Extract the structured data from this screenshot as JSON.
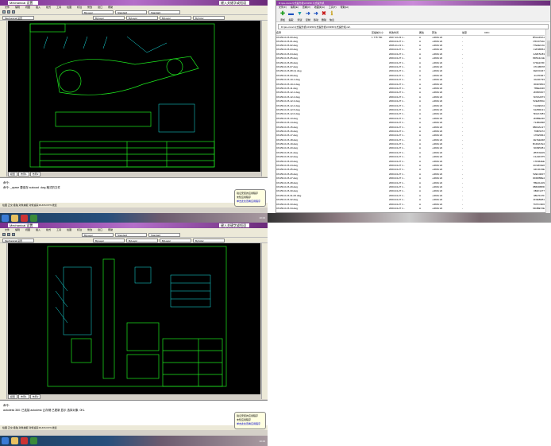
{
  "cad": {
    "title_field": "Mechanical 设置",
    "search_field": "键入关键字或短语",
    "menus": [
      "文件",
      "编辑",
      "视图",
      "插入",
      "格式",
      "工具",
      "绘图",
      "标注",
      "修改",
      "窗口",
      "帮助"
    ],
    "toolbar_selects": [
      "Mechanical 设置",
      "ByLayer",
      "Standard",
      "Standard"
    ],
    "layer_selects": [
      "ByLayer",
      "ByLayer",
      "ByLayer",
      "ByColor"
    ],
    "tabs": [
      "模型",
      "布局1",
      "布局2"
    ],
    "line_color": "#1ee81e",
    "accent_color": "#19e6e6"
  },
  "top_cad": {
    "cmd_lines": [
      "命令:",
      "命令: _qsave 要保存 autocad .dwg 格式的文件"
    ],
    "status": "绘图 正交 极轴 对象捕捉 对象追踪 DUCS DYN 线宽"
  },
  "bottom_cad": {
    "cmd_lines": [
      "命令:",
      "autodesk 360: 已连接 autodesk 云存储 已更新 显示 选择对象: 0KL"
    ],
    "status": "绘图 正交 极轴 对象捕捉 对象追踪 DUCS DYN 线宽"
  },
  "balloon": {
    "title": "验证安装的应用程序",
    "body": "未知应用程序",
    "link": "单击此处查看应用程序"
  },
  "explorer": {
    "title": "D:\\pre-zone\\斗式提升机\\CN150 斗式提升机",
    "menus": [
      "文件(F)",
      "编辑(E)",
      "查看(V)",
      "收藏夹(A)",
      "工具(T)",
      "帮助(H)"
    ],
    "tools": [
      {
        "icon": "add-icon",
        "label": "添加",
        "glyph": "✚"
      },
      {
        "icon": "extract-icon",
        "label": "提取",
        "glyph": "▬"
      },
      {
        "icon": "test-icon",
        "label": "测试",
        "glyph": "▼"
      },
      {
        "icon": "copy-icon",
        "label": "复制",
        "glyph": "➜"
      },
      {
        "icon": "move-icon",
        "label": "移动",
        "glyph": "➜"
      },
      {
        "icon": "delete-icon",
        "label": "删除",
        "glyph": "✖"
      },
      {
        "icon": "info-icon",
        "label": "信息",
        "glyph": "ℹ"
      }
    ],
    "address": "D:\\pre-zone\\斗式提升机\\CN150斗式提升机\\CN150斗式提升机.rar\\",
    "columns": [
      "名称",
      "压缩前大小",
      "修改时间",
      "属性",
      "注释",
      "算法",
      "加密",
      "创建时间",
      "访问时间",
      "CRC"
    ],
    "rows": [
      [
        "CN150-0-15-00.dwg",
        "1 778 790",
        "2007-10-23 1...",
        "A",
        "-LZMA:24",
        "-",
        "B5AAF6A1"
      ],
      [
        "CN150-0-15-01.dwg",
        "",
        "2003-04-27 1...",
        "A",
        "-LZMA:24",
        "-",
        "C5C0794A"
      ],
      [
        "CN150-0-15-02.dwg",
        "",
        "2006-11-21 1...",
        "A",
        "-LZMA:24",
        "-",
        "77E2EC2A"
      ],
      [
        "CN150-0-15-03.dwg",
        "",
        "2003-04-27 1...",
        "A",
        "-LZMA:24",
        "-",
        "C2F9B654"
      ],
      [
        "CN150-0-15-04.dwg",
        "",
        "2003-04-27 1...",
        "A",
        "-LZMA:24",
        "-",
        "4A8F5C83"
      ],
      [
        "CN150-0-15-05.dwg",
        "",
        "2003-04-27 1...",
        "A",
        "-LZMA:24",
        "-",
        "8D5A3A1E"
      ],
      [
        "CN150-0-15-06.dwg",
        "",
        "2003-04-27 1...",
        "A",
        "-LZMA:24",
        "-",
        "37FE2C5F"
      ],
      [
        "CN150-0-15-07.dwg",
        "",
        "2003-04-27 1...",
        "A",
        "-LZMA:24",
        "-",
        "47C4B678"
      ],
      [
        "CN150-0-15-08 (1).dwg",
        "",
        "2003-04-27 1...",
        "A",
        "-LZMA:24",
        "-",
        "3EF0C047"
      ],
      [
        "CN150-0-15-09.dwg",
        "",
        "2003-04-27 1...",
        "A",
        "-LZMA:24",
        "-",
        "2147F847"
      ],
      [
        "CN150-0-15-10-1.dwg",
        "",
        "2003-04-27 1...",
        "A",
        "-LZMA:24",
        "-",
        "3A44F793"
      ],
      [
        "CN150-0-15-10-2.dwg",
        "",
        "2003-04-27 1...",
        "A",
        "-LZMA:24",
        "-",
        "3D4F9504"
      ],
      [
        "CN150-0-15-11.dwg",
        "",
        "2003-04-27 1...",
        "A",
        "-LZMA:24",
        "-",
        "789E2220"
      ],
      [
        "CN150-0-15-12-1.dwg",
        "",
        "2003-04-27 1...",
        "A",
        "-LZMA:24",
        "-",
        "2F8D6F07"
      ],
      [
        "CN150-0-15-12-2.dwg",
        "",
        "2003-04-27 1...",
        "A",
        "-LZMA:24",
        "-",
        "6C5A2073"
      ],
      [
        "CN150-0-15-12-3.dwg",
        "",
        "2003-04-27 1...",
        "A",
        "-LZMA:24",
        "-",
        "52E2D50A"
      ],
      [
        "CN150-0-15-12-4.dwg",
        "",
        "2003-04-27 1...",
        "A",
        "-LZMA:24",
        "-",
        "71A0E5A3"
      ],
      [
        "CN150-0-15-12-5.dwg",
        "",
        "2003-04-27 1...",
        "A",
        "-LZMA:24",
        "-",
        "612B9C21"
      ],
      [
        "CN150-0-15-12-6.dwg",
        "",
        "2003-04-27 1...",
        "A",
        "-LZMA:24",
        "-",
        "5D4A7283"
      ],
      [
        "CN150-0-15-13.dwg",
        "",
        "2003-04-27 1...",
        "A",
        "-LZMA:24",
        "-",
        "2F8BE230"
      ],
      [
        "CN150-0-15-14.dwg",
        "",
        "2003-04-27 1...",
        "A",
        "-LZMA:24",
        "-",
        "714BA838"
      ],
      [
        "CN150-0-15-15.dwg",
        "",
        "2003-04-27 1...",
        "A",
        "-LZMA:24",
        "-",
        "9BD3AC27"
      ],
      [
        "CN150-0-15-16.dwg",
        "",
        "2003-04-27 1...",
        "A",
        "-LZMA:24",
        "-",
        "798F5272"
      ],
      [
        "CN150-0-15-17.dwg",
        "",
        "2003-04-27 1...",
        "A",
        "-LZMA:24",
        "-",
        "17FE5844"
      ],
      [
        "CN150-0-15-18.dwg",
        "",
        "2003-04-27 1...",
        "A",
        "-LZMA:24",
        "-",
        "4E7EE948"
      ],
      [
        "CN150-0-15-19.dwg",
        "",
        "2003-04-27 1...",
        "A",
        "-LZMA:24",
        "-",
        "B1D0A7E4"
      ],
      [
        "CN150-0-15-20.dwg",
        "",
        "2003-04-27 1...",
        "A",
        "-LZMA:24",
        "-",
        "6D095F81"
      ],
      [
        "CN150-0-15-21.dwg",
        "",
        "2003-04-27 1...",
        "A",
        "-LZMA:24",
        "-",
        "2B7F9A09"
      ],
      [
        "CN150-0-15-22.dwg",
        "",
        "2003-04-27 1...",
        "A",
        "-LZMA:24",
        "-",
        "C1A2F075"
      ],
      [
        "CN150-0-15-23.dwg",
        "",
        "2003-04-27 1...",
        "A",
        "-LZMA:24",
        "-",
        "17F962EE"
      ],
      [
        "CN150-0-15-24.dwg",
        "",
        "2003-04-27 1...",
        "A",
        "-LZMA:24",
        "-",
        "4C32D1E6"
      ],
      [
        "CN150-0-15-25.dwg",
        "",
        "2003-04-27 1...",
        "A",
        "-LZMA:24",
        "-",
        "44C4133E"
      ],
      [
        "CN150-0-15-26.dwg",
        "",
        "2003-04-27 1...",
        "A",
        "-LZMA:24",
        "-",
        "52EC4D07"
      ],
      [
        "CN150-0-15-27.dwg",
        "",
        "2003-04-27 1...",
        "A",
        "-LZMA:24",
        "-",
        "0D9FBBE4"
      ],
      [
        "CN150-0-15-28.dwg",
        "",
        "2003-04-27 1...",
        "A",
        "-LZMA:24",
        "-",
        "7BE31A09"
      ],
      [
        "CN150-0-15-29.dwg",
        "",
        "2003-04-27 1...",
        "A",
        "-LZMA:24",
        "-",
        "3B6D0B8D"
      ],
      [
        "CN150-0-15-30.dwg",
        "",
        "2003-04-27 1...",
        "A",
        "-LZMA:24",
        "-",
        "0B2F1277"
      ],
      [
        "CN150-0-15-31-00.dwg",
        "",
        "2003-04-27 1...",
        "A",
        "-LZMA:24",
        "-",
        "08E7F27F"
      ],
      [
        "CN150-0-15-32.dwg",
        "",
        "2003-04-27 1...",
        "A",
        "-LZMA:24",
        "-",
        "4F0E8EB1"
      ],
      [
        "CN150-0-15-33.dwg",
        "",
        "2003-04-27 1...",
        "A",
        "-LZMA:24",
        "-",
        "767FC3D6"
      ],
      [
        "CN150-0-15-34.dwg",
        "",
        "2003-04-27 1...",
        "A",
        "-LZMA:24",
        "-",
        "9D4BE72E"
      ]
    ]
  },
  "taskbar": {
    "clock": "10:23"
  }
}
